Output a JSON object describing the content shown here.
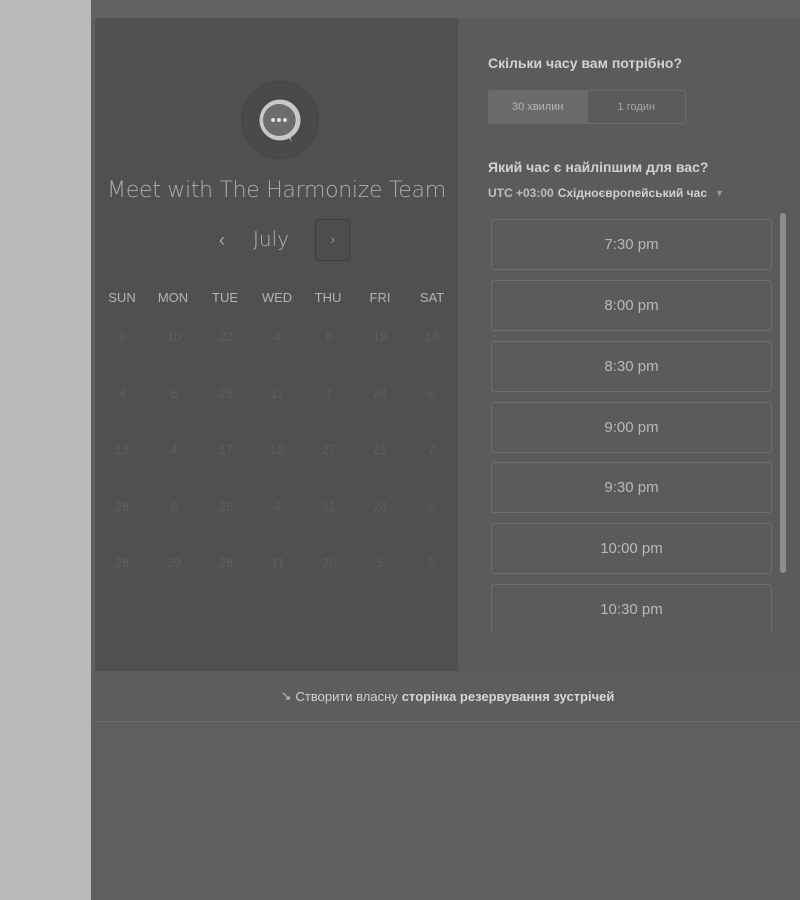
{
  "widget": {
    "title": "Meet with The Harmonize Team",
    "logo_icon": "chat-bubble-icon"
  },
  "calendar": {
    "month": "July",
    "prev_icon": "‹",
    "next_icon": "›",
    "days_of_week": [
      "SUN",
      "MON",
      "TUE",
      "WED",
      "THU",
      "FRI",
      "SAT"
    ],
    "weeks": [
      [
        "9",
        "10",
        "22",
        "4",
        "8",
        "19",
        "18"
      ],
      [
        "4",
        "6",
        "28",
        "11",
        "7",
        "24",
        "6"
      ],
      [
        "13",
        "4",
        "17",
        "18",
        "27",
        "21",
        "7"
      ],
      [
        "28",
        "8",
        "26",
        "4",
        "11",
        "24",
        "6"
      ],
      [
        "28",
        "29",
        "28",
        "31",
        "26",
        "5",
        "5"
      ]
    ]
  },
  "booking": {
    "duration_question": "Скільки часу вам потрібно?",
    "durations": [
      {
        "label": "30 хвилин",
        "selected": true
      },
      {
        "label": "1 годин",
        "selected": false
      }
    ],
    "time_question": "Який час є найліпшим для вас?",
    "timezone_offset": "UTC +03:00",
    "timezone_name": "Східноєвропейський час",
    "slots": [
      "7:30 pm",
      "8:00 pm",
      "8:30 pm",
      "9:00 pm",
      "9:30 pm",
      "10:00 pm",
      "10:30 pm"
    ]
  },
  "footer": {
    "icon": "↘",
    "text_prefix": "Створити власну",
    "link_text": "сторінка резервування зустрічей"
  }
}
